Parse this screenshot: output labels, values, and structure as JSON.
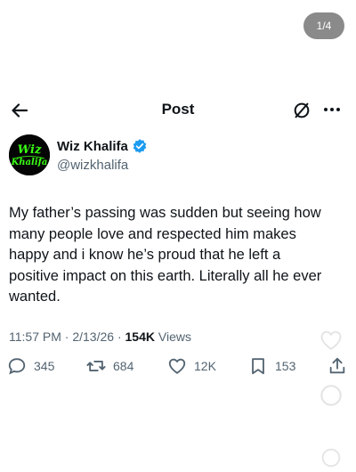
{
  "page_counter": "1/4",
  "header": {
    "title": "Post"
  },
  "author": {
    "name": "Wiz Khalifa",
    "handle": "@wizkhalifa",
    "avatar_text": "Wiz Khalifa"
  },
  "tweet": {
    "line1": "My father’s passing was sudden but seeing how",
    "line2": "many people love and respected him makes",
    "line3": "happy and i know he’s proud that he left a",
    "line4": "positive impact on this earth. Literally all he ever",
    "line5": "wanted."
  },
  "meta": {
    "time": "11:57 PM",
    "date": "2/13/26",
    "separator": "·",
    "views_count": "154K",
    "views_label": "Views"
  },
  "actions": {
    "replies": "345",
    "reposts": "684",
    "likes": "12K",
    "bookmarks": "153"
  },
  "icons": [
    "back-arrow-icon",
    "grok-icon",
    "more-icon",
    "verified-icon",
    "reply-icon",
    "repost-icon",
    "like-icon",
    "bookmark-icon",
    "share-icon"
  ],
  "colors": {
    "text": "#0f1419",
    "secondary": "#536471",
    "verified": "#1d9bf0",
    "avatar_neon": "#39ff14"
  }
}
